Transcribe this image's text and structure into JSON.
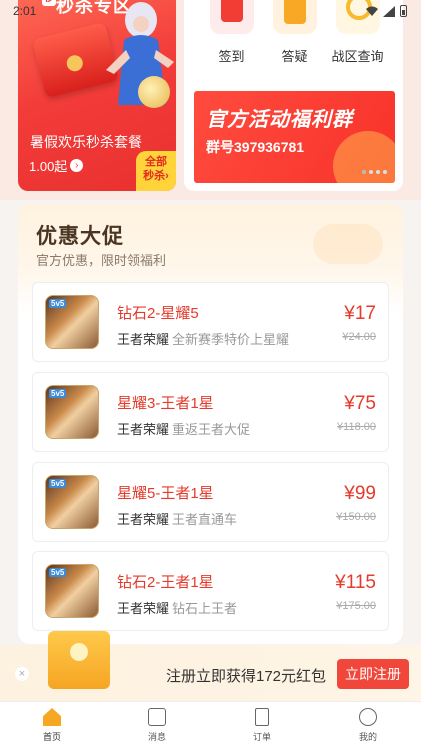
{
  "status_bar": {
    "time": "2:01"
  },
  "flash_sale": {
    "title": "秒杀专区",
    "package_name": "暑假欢乐秒杀套餐",
    "price": "1.00起",
    "all_label_line1": "全部",
    "all_label_line2": "秒杀"
  },
  "quick_actions": [
    {
      "label": "签到",
      "icon": "checkin-icon"
    },
    {
      "label": "答疑",
      "icon": "faq-icon"
    },
    {
      "label": "战区查询",
      "icon": "server-search-icon"
    }
  ],
  "banner": {
    "title": "官方活动福利群",
    "group": "群号397936781"
  },
  "promo": {
    "title": "优惠大促",
    "subtitle": "官方优惠，限时领福利",
    "items": [
      {
        "title": "钻石2-星耀5",
        "game": "王者荣耀",
        "desc": "全新赛季特价上星耀",
        "price": "¥17",
        "original": "¥24.00",
        "tag": "5v5"
      },
      {
        "title": "星耀3-王者1星",
        "game": "王者荣耀",
        "desc": "重返王者大促",
        "price": "¥75",
        "original": "¥118.00",
        "tag": "5v5"
      },
      {
        "title": "星耀5-王者1星",
        "game": "王者荣耀",
        "desc": "王者直通车",
        "price": "¥99",
        "original": "¥150.00",
        "tag": "5v5"
      },
      {
        "title": "钻石2-王者1星",
        "game": "王者荣耀",
        "desc": "钻石上王者",
        "price": "¥115",
        "original": "¥175.00",
        "tag": "5v5"
      }
    ]
  },
  "register_bar": {
    "text": "注册立即获得172元红包",
    "button": "立即注册",
    "close": "×"
  },
  "tabs": [
    {
      "label": "首页",
      "icon": "home-icon",
      "active": true
    },
    {
      "label": "消息",
      "icon": "message-icon",
      "active": false
    },
    {
      "label": "订单",
      "icon": "order-icon",
      "active": false
    },
    {
      "label": "我的",
      "icon": "profile-icon",
      "active": false
    }
  ],
  "colors": {
    "accent": "#e43b2c",
    "button": "#f0473a",
    "tab_active": "#f6a825"
  }
}
